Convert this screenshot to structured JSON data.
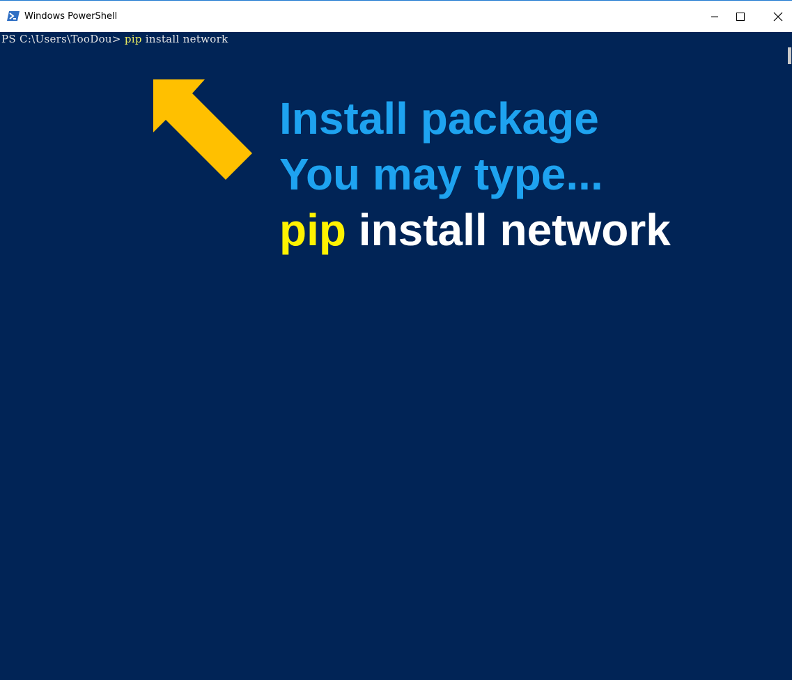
{
  "window": {
    "title": "Windows PowerShell",
    "icon": "powershell-icon",
    "controls": [
      "minimize-icon",
      "maximize-icon",
      "close-icon"
    ]
  },
  "console": {
    "prompt": "PS C:\\Users\\TooDou> ",
    "command_keyword": "pip",
    "command_rest": " install network"
  },
  "callout": {
    "line1": "Install package",
    "line2": "You may type...",
    "line3_keyword": "pip",
    "line3_rest": " install network"
  },
  "colors": {
    "console_bg": "#012456",
    "callout_blue": "#1ea3f0",
    "keyword_yellow": "#fff200",
    "arrow": "#ffc000"
  }
}
